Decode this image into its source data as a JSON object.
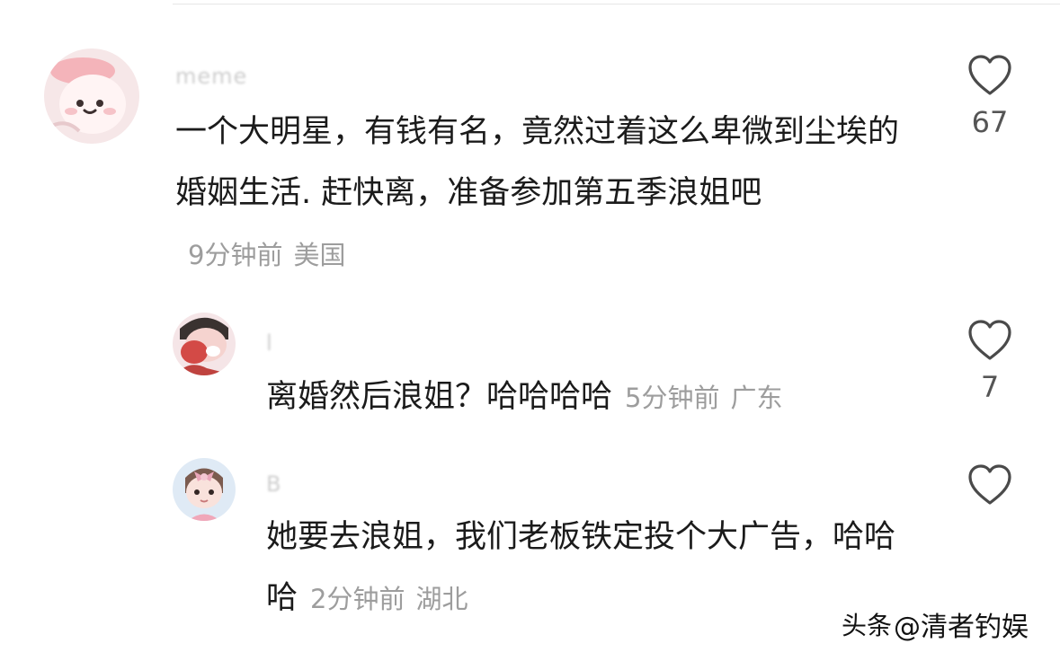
{
  "comments": [
    {
      "username": "meme",
      "text": "一个大明星，有钱有名，竟然过着这么卑微到尘埃的婚姻生活. 赶快离，准备参加第五季浪姐吧",
      "time": "9分钟前",
      "location": "美国",
      "likes": "67"
    },
    {
      "username": "l",
      "text": "离婚然后浪姐？哈哈哈哈",
      "time": "5分钟前",
      "location": "广东",
      "likes": "7"
    },
    {
      "username": "B",
      "text": "她要去浪姐，我们老板铁定投个大广告，哈哈哈",
      "time": "2分钟前",
      "location": "湖北",
      "likes": ""
    }
  ],
  "watermark": {
    "prefix": "头条",
    "handle": "@清者钓娱"
  },
  "icons": {
    "like": "heart-outline-icon"
  },
  "colors": {
    "text": "#1b1b1b",
    "meta": "#9d9d9d",
    "icon": "#4a4a4a"
  }
}
